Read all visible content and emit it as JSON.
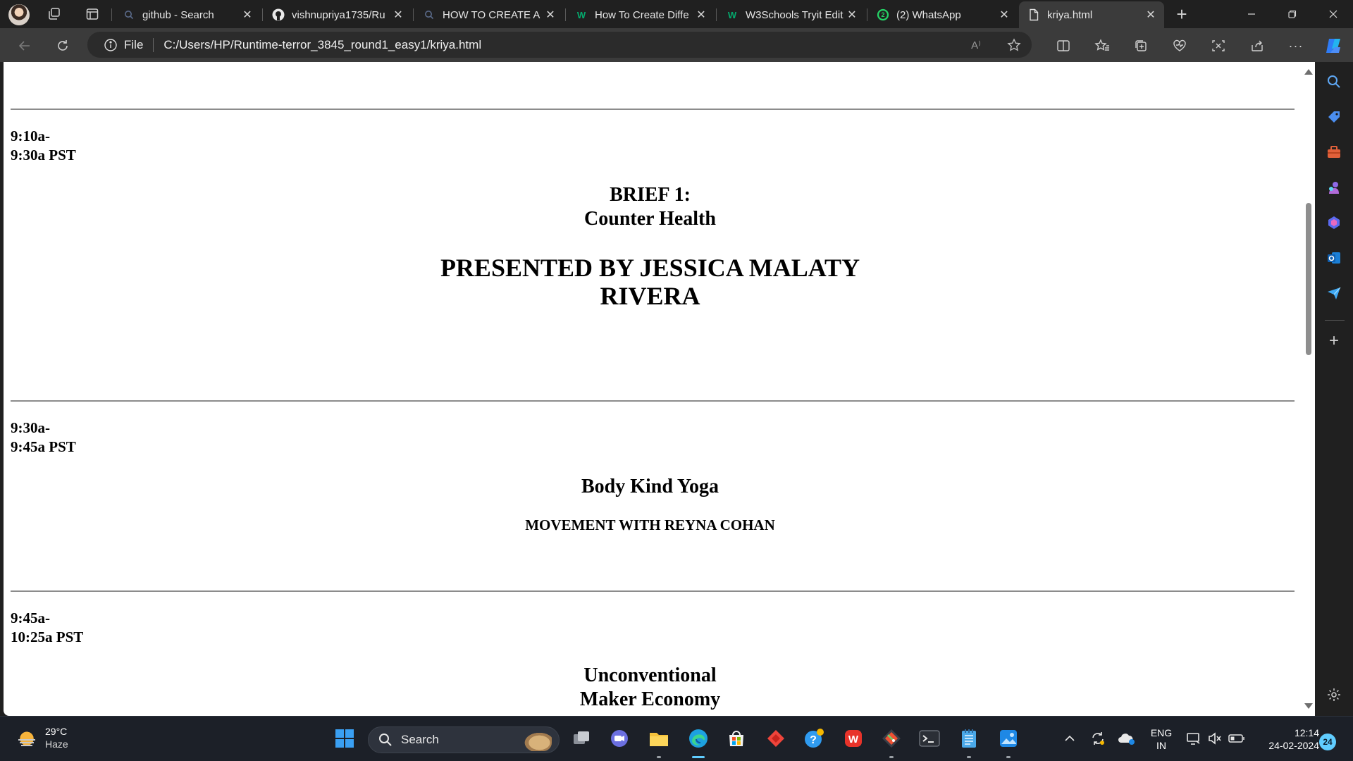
{
  "browser": {
    "tabs": [
      {
        "label": "github - Search",
        "icon": "search-icon"
      },
      {
        "label": "vishnupriya1735/Ru",
        "icon": "github-icon"
      },
      {
        "label": "HOW TO CREATE A",
        "icon": "search-icon"
      },
      {
        "label": "How To Create Diffe",
        "icon": "w3schools-icon"
      },
      {
        "label": "W3Schools Tryit Edit",
        "icon": "w3schools-icon"
      },
      {
        "label": "(2) WhatsApp",
        "icon": "whatsapp-icon",
        "badge": "2"
      },
      {
        "label": "kriya.html",
        "icon": "file-icon",
        "active": true
      }
    ],
    "address": {
      "scheme_label": "File",
      "url": "C:/Users/HP/Runtime-terror_3845_round1_easy1/kriya.html"
    },
    "read_aloud_label": "A⁾"
  },
  "page": {
    "sessions": [
      {
        "time_start": "9:10a-",
        "time_end": "9:30a PST",
        "title_line1": "BRIEF 1:",
        "title_line2": "Counter Health",
        "presenter_line1": "PRESENTED BY JESSICA MALATY",
        "presenter_line2": "RIVERA"
      },
      {
        "time_start": "9:30a-",
        "time_end": "9:45a PST",
        "title": "Body Kind Yoga",
        "subtitle": "MOVEMENT WITH REYNA COHAN"
      },
      {
        "time_start": "9:45a-",
        "time_end": "10:25a PST",
        "title_line1": "Unconventional",
        "title_line2": "Maker Economy"
      }
    ]
  },
  "taskbar": {
    "weather": {
      "temp": "29°C",
      "condition": "Haze"
    },
    "search_label": "Search",
    "language": {
      "line1": "ENG",
      "line2": "IN"
    },
    "clock": {
      "time": "12:14",
      "date": "24-02-2024"
    },
    "notification_count": "24"
  },
  "colors": {
    "accent": "#60cdff",
    "tab_bg": "#202020",
    "toolbar_bg": "#3b3b3b",
    "whatsapp": "#25d366",
    "copilot": "#2f7cf6"
  }
}
